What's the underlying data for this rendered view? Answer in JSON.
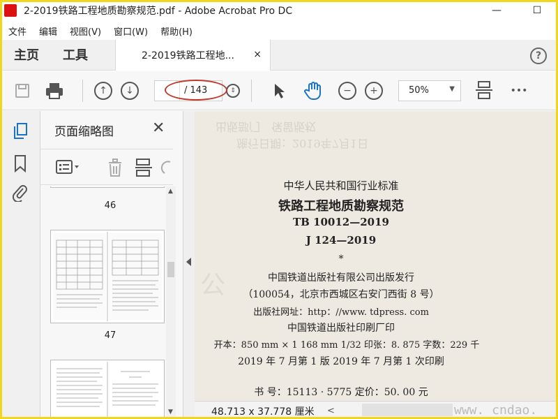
{
  "window": {
    "title": "2-2019铁路工程地质勘察规范.pdf - Adobe Acrobat Pro DC",
    "minimize": "—",
    "maximize": "☐"
  },
  "menu": [
    "文件",
    "编辑",
    "视图(V)",
    "窗口(W)",
    "帮助(H)"
  ],
  "tabs": {
    "home": "主页",
    "tools": "工具",
    "document": "2-2019铁路工程地...",
    "close": "×",
    "help": "?"
  },
  "toolbar": {
    "page_current": "",
    "page_total": "/ 143",
    "zoom": "50%",
    "more": "•••"
  },
  "panel": {
    "title": "页面缩略图",
    "close": "✕",
    "thumbnails": [
      {
        "label": "46"
      },
      {
        "label": "47"
      },
      {
        "label": ""
      }
    ]
  },
  "document": {
    "lines": [
      "中华人民共和国行业标准",
      "铁路工程地质勘察规范",
      "TB 10012—2019",
      "J 124—2019",
      "*",
      "中国铁道出版社有限公司出版发行",
      "（100054，北京市西城区右安门西街 8 号）",
      "出版社网址：http：//www. tdpress. com",
      "中国铁道出版社印刷厂印",
      "开本：850 mm × 1 168 mm  1/32  印张：8. 875  字数：229 千",
      "2019 年 7 月第 1 版  2019 年 7 月第 1 次印刷",
      "书  号：15113 · 5775    定价：50. 00 元"
    ]
  },
  "status": {
    "dimensions": "48.713 x 37.778 厘米",
    "scroll_left": "<",
    "watermark": "www. cndao. com"
  },
  "colors": {
    "accent_blue": "#1a73c7",
    "annotation_red": "#c0392b",
    "frame_yellow": "#f2d51d"
  }
}
